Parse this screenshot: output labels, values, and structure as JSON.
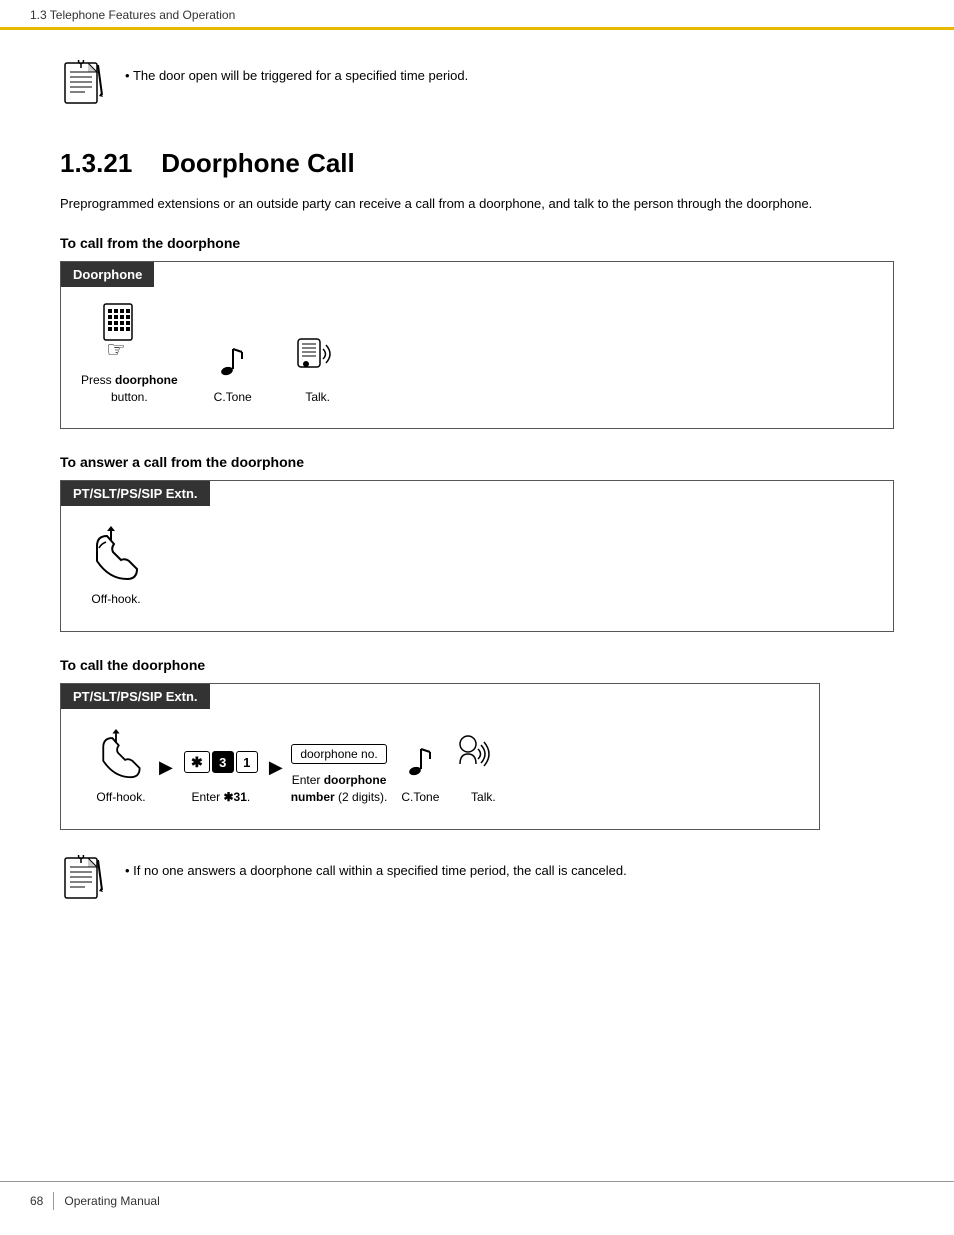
{
  "header": {
    "breadcrumb": "1.3 Telephone Features and Operation"
  },
  "top_note": {
    "text": "The door open will be triggered for a specified time period."
  },
  "section": {
    "number": "1.3.21",
    "title": "Doorphone Call",
    "description": "Preprogrammed extensions or an outside party can receive a call from a doorphone, and talk to the person through the doorphone."
  },
  "subsections": [
    {
      "id": "call_from",
      "title": "To call from the doorphone",
      "box_label": "Doorphone",
      "steps": [
        {
          "id": "press_doorphone",
          "icon_type": "doorphone_keypad_hand",
          "label": "Press doorphone button.",
          "bold_parts": [
            "doorphone"
          ]
        },
        {
          "id": "c_tone_1",
          "icon_type": "ctone",
          "label": "C.Tone",
          "bold_parts": []
        },
        {
          "id": "talk_1",
          "icon_type": "doorphone_talk",
          "label": "Talk.",
          "bold_parts": []
        }
      ]
    },
    {
      "id": "answer_from",
      "title": "To answer a call from the doorphone",
      "box_label": "PT/SLT/PS/SIP Extn.",
      "steps": [
        {
          "id": "offhook_1",
          "icon_type": "phone_offhook",
          "label": "Off-hook.",
          "bold_parts": []
        }
      ]
    },
    {
      "id": "call_the",
      "title": "To call the doorphone",
      "box_label": "PT/SLT/PS/SIP Extn.",
      "steps": [
        {
          "id": "offhook_2",
          "icon_type": "phone_offhook",
          "label": "Off-hook.",
          "bold_parts": []
        },
        {
          "id": "arrow_1",
          "icon_type": "arrow",
          "label": ""
        },
        {
          "id": "enter_star31",
          "icon_type": "key_star31",
          "label": "Enter ✱31.",
          "bold_parts": []
        },
        {
          "id": "arrow_2",
          "icon_type": "arrow",
          "label": ""
        },
        {
          "id": "enter_doorphone_no",
          "icon_type": "doorphone_no",
          "label": "Enter doorphone number (2 digits).",
          "bold_parts": [
            "doorphone",
            "number"
          ]
        },
        {
          "id": "c_tone_2",
          "icon_type": "ctone",
          "label": "C.Tone",
          "bold_parts": []
        },
        {
          "id": "talk_2",
          "icon_type": "talk_phone",
          "label": "Talk.",
          "bold_parts": []
        }
      ]
    }
  ],
  "bottom_note": {
    "text": "If no one answers a doorphone call within a specified time period, the call is canceled."
  },
  "footer": {
    "page_number": "68",
    "manual_label": "Operating Manual"
  }
}
